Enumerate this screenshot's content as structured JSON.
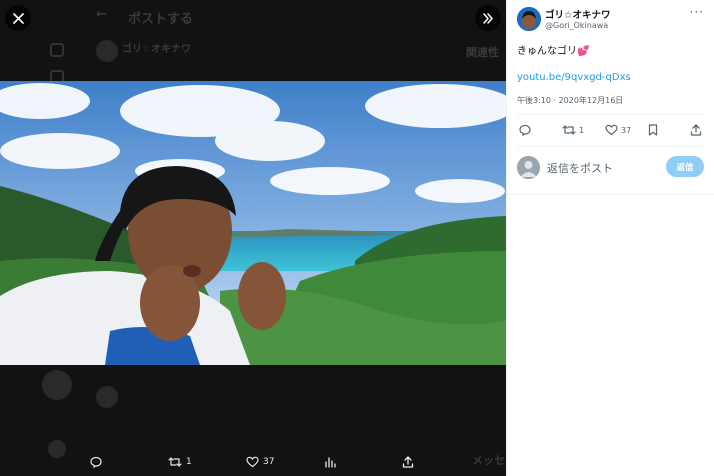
{
  "viewer": {
    "header_title": "ポストする",
    "ghost_name": "ゴリ☆オキナワ",
    "ghost_right_title": "関連性",
    "ghost_right_bottom": "メッセ",
    "actions": {
      "retweets": "1",
      "likes": "37"
    }
  },
  "tweet": {
    "author_name": "ゴリ☆オキナワ",
    "author_handle": "@Gori_Okinawa",
    "text": "きゅんなゴリ",
    "emoji": "💕",
    "link": "youtu.be/9qvxgd-qDxs",
    "timestamp": "午後3:10 · 2020年12月16日",
    "retweets": "1",
    "likes": "37"
  },
  "reply": {
    "placeholder": "返信をポスト",
    "button_label": "返信"
  },
  "colors": {
    "accent": "#1d9bf0",
    "reply_button": "#8ecdf8",
    "viewer_bg": "#121212"
  },
  "icons": [
    "close-icon",
    "expand-icon",
    "more-icon",
    "reply-icon",
    "retweet-icon",
    "like-icon",
    "analytics-icon",
    "bookmark-icon",
    "share-icon"
  ]
}
